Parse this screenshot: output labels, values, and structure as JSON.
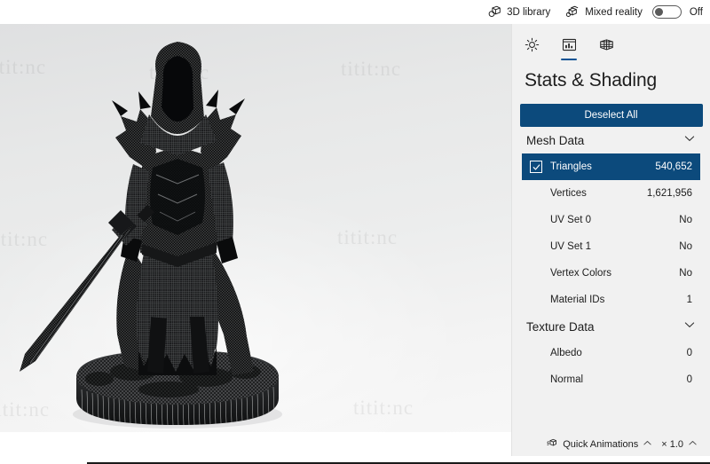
{
  "topbar": {
    "library_label": "3D library",
    "library_icon": "cube-library-icon",
    "mixed_reality_label": "Mixed reality",
    "mixed_reality_icon": "mixed-reality-icon",
    "toggle_state_label": "Off",
    "toggle_on": false
  },
  "viewport": {
    "model_name": "armored-knight-with-sword",
    "watermark_text": "titit:nc",
    "background_color": "#ecedee"
  },
  "panel": {
    "title": "Stats & Shading",
    "accent_color": "#0c4a7c",
    "background_color": "#f1f1f1",
    "tabs": [
      {
        "icon": "sun-lighting-icon",
        "selected": false
      },
      {
        "icon": "stats-shading-icon",
        "selected": true
      },
      {
        "icon": "grid-mesh-icon",
        "selected": false
      }
    ],
    "deselect_label": "Deselect All",
    "sections": [
      {
        "title": "Mesh Data",
        "expanded": true,
        "rows": [
          {
            "name": "Triangles",
            "value": "540,652",
            "selected": true,
            "checkbox": true
          },
          {
            "name": "Vertices",
            "value": "1,621,956",
            "selected": false,
            "checkbox": false
          },
          {
            "name": "UV Set 0",
            "value": "No",
            "selected": false,
            "checkbox": false
          },
          {
            "name": "UV Set 1",
            "value": "No",
            "selected": false,
            "checkbox": false
          },
          {
            "name": "Vertex Colors",
            "value": "No",
            "selected": false,
            "checkbox": false
          },
          {
            "name": "Material IDs",
            "value": "1",
            "selected": false,
            "checkbox": false
          }
        ]
      },
      {
        "title": "Texture Data",
        "expanded": true,
        "rows": [
          {
            "name": "Albedo",
            "value": "0",
            "selected": false,
            "checkbox": false
          },
          {
            "name": "Normal",
            "value": "0",
            "selected": false,
            "checkbox": false
          }
        ]
      }
    ]
  },
  "bottombar": {
    "quick_animations_label": "Quick Animations",
    "quick_animations_icon": "animation-cube-icon",
    "speed_label": "× 1.0"
  }
}
